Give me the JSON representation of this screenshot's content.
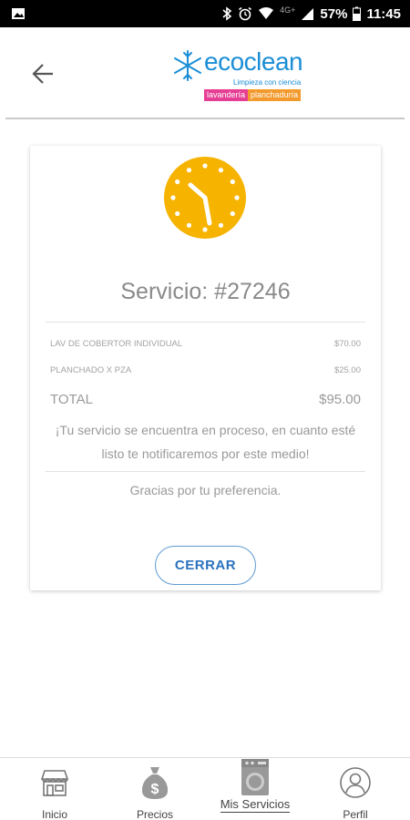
{
  "status_bar": {
    "network": "4G+",
    "battery": "57%",
    "time": "11:45",
    "icons": [
      "image-icon",
      "bluetooth-icon",
      "alarm-icon",
      "wifi-icon",
      "signal-icon",
      "battery-icon"
    ]
  },
  "header": {
    "back_icon": "arrow-left-icon",
    "logo": {
      "name": "ecoclean",
      "subtitle": "Limpieza con ciencia",
      "tag_left": "lavandería",
      "tag_right": "planchaduría"
    }
  },
  "service": {
    "title": "Servicio: #27246",
    "status_icon": "clock-icon",
    "items": [
      {
        "name": "LAV DE COBERTOR INDIVIDUAL",
        "price": "$70.00"
      },
      {
        "name": "PLANCHADO X PZA",
        "price": "$25.00"
      }
    ],
    "total_label": "TOTAL",
    "total_value": "$95.00",
    "message": "¡Tu servicio se encuentra en proceso, en cuanto esté listo te notificaremos por este medio!",
    "thanks": "Gracias por tu preferencia.",
    "close_label": "CERRAR"
  },
  "bottom_nav": {
    "items": [
      {
        "label": "Inicio",
        "icon": "store-icon"
      },
      {
        "label": "Precios",
        "icon": "money-bag-icon"
      },
      {
        "label": "Mis Servicios",
        "icon": "washing-machine-icon",
        "active": true
      },
      {
        "label": "Perfil",
        "icon": "user-icon"
      }
    ]
  },
  "colors": {
    "accent": "#2b73bd",
    "clock": "#f6b300",
    "logo_blue": "#1b8ed6",
    "tag_pink": "#e63e94",
    "tag_orange": "#f39a2d"
  }
}
